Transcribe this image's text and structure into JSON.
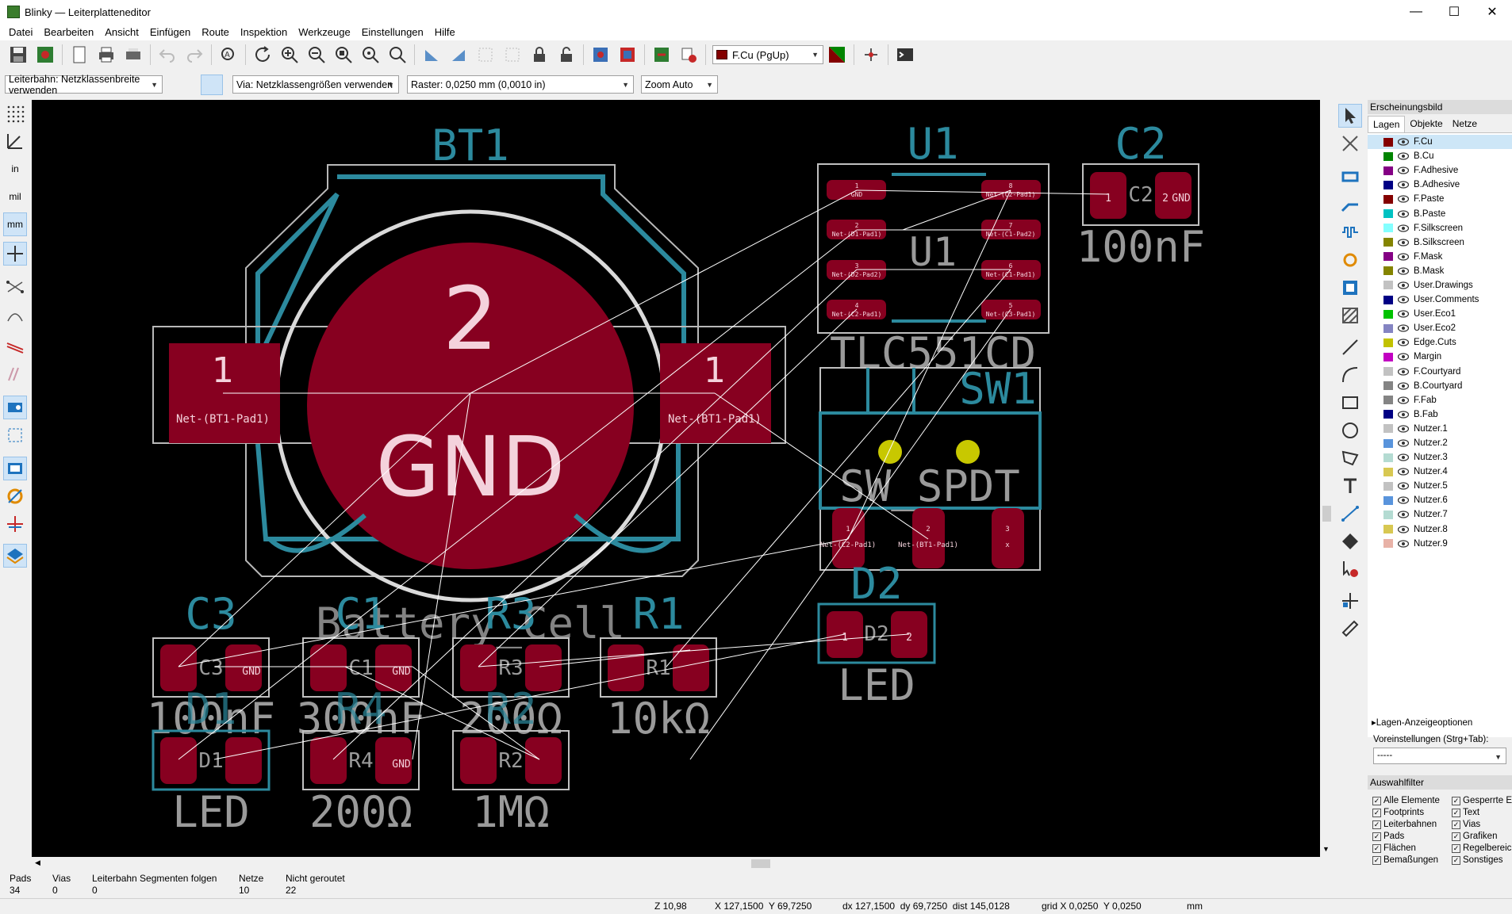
{
  "window": {
    "title": "Blinky — Leiterplatteneditor",
    "minimize": "—",
    "maximize": "☐",
    "close": "✕"
  },
  "menu": [
    "Datei",
    "Bearbeiten",
    "Ansicht",
    "Einfügen",
    "Route",
    "Inspektion",
    "Werkzeuge",
    "Einstellungen",
    "Hilfe"
  ],
  "toolbar": {
    "layer_select": "F.Cu (PgUp)",
    "layer_color": "#840000"
  },
  "toolbar2": {
    "track_width": "Leiterbahn: Netzklassenbreite verwenden",
    "via_size": "Via: Netzklassengrößen verwenden",
    "grid": "Raster: 0,0250 mm (0,0010 in)",
    "zoom": "Zoom Auto"
  },
  "left_tools": {
    "unit_in": "in",
    "unit_mil": "mil",
    "unit_mm": "mm"
  },
  "pcb": {
    "bt1": {
      "ref": "BT1",
      "value": "Battery_Cell",
      "pad_center_num": "2",
      "pad_center_net": "GND",
      "pad_num": "1",
      "pad_net": "Net-(BT1-Pad1)"
    },
    "u1": {
      "ref": "U1",
      "value": "TLC551CD",
      "ref_center": "U1",
      "pads_left": [
        {
          "num": "1",
          "net": "GND"
        },
        {
          "num": "2",
          "net": "Net-(D1-Pad1)"
        },
        {
          "num": "3",
          "net": "Net-(D2-Pad2)"
        },
        {
          "num": "4",
          "net": "Net-(C2-Pad1)"
        }
      ],
      "pads_right": [
        {
          "num": "8",
          "net": "Net-(C2-Pad1)"
        },
        {
          "num": "7",
          "net": "Net-(C1-Pad2)"
        },
        {
          "num": "6",
          "net": "Net-(C1-Pad1)"
        },
        {
          "num": "5",
          "net": "Net-(C3-Pad1)"
        }
      ]
    },
    "c2": {
      "ref": "C2",
      "value": "100nF",
      "ref_center": "C2",
      "pad1": "1",
      "pad2": "2",
      "pad2_net": "GND"
    },
    "sw1": {
      "ref": "SW1",
      "value": "SW_SPDT",
      "pads": [
        {
          "num": "1",
          "net": "Net-(C2-Pad1)"
        },
        {
          "num": "2",
          "net": "Net-(BT1-Pad1)"
        },
        {
          "num": "3",
          "net": "x"
        }
      ]
    },
    "d2": {
      "ref": "D2",
      "value": "LED",
      "ref_center": "D2",
      "pad1": "1",
      "pad2": "2"
    },
    "c3": {
      "ref": "C3",
      "value": "100nF",
      "ref_center": "C3",
      "pad2_net": "GND"
    },
    "c1": {
      "ref": "C1",
      "value": "300nF",
      "ref_center": "C1",
      "pad2_net": "GND"
    },
    "r3": {
      "ref": "R3",
      "value": "200Ω",
      "ref_center": "R3"
    },
    "r1": {
      "ref": "R1",
      "value": "10kΩ",
      "ref_center": "R1"
    },
    "d1": {
      "ref": "D1",
      "value": "LED",
      "ref_center": "D1"
    },
    "r4": {
      "ref": "R4",
      "value": "200Ω",
      "ref_center": "R4",
      "pad2_net": "GND"
    },
    "r2": {
      "ref": "R2",
      "value": "1MΩ",
      "ref_center": "R2"
    }
  },
  "panel": {
    "header": "Erscheinungsbild",
    "tabs": [
      "Lagen",
      "Objekte",
      "Netze"
    ],
    "layers": [
      {
        "name": "F.Cu",
        "color": "#840000"
      },
      {
        "name": "B.Cu",
        "color": "#008400"
      },
      {
        "name": "F.Adhesive",
        "color": "#840084"
      },
      {
        "name": "B.Adhesive",
        "color": "#000084"
      },
      {
        "name": "F.Paste",
        "color": "#840000"
      },
      {
        "name": "B.Paste",
        "color": "#00c2c2"
      },
      {
        "name": "F.Silkscreen",
        "color": "#84ffff"
      },
      {
        "name": "B.Silkscreen",
        "color": "#848400"
      },
      {
        "name": "F.Mask",
        "color": "#840084"
      },
      {
        "name": "B.Mask",
        "color": "#848400"
      },
      {
        "name": "User.Drawings",
        "color": "#c2c2c2"
      },
      {
        "name": "User.Comments",
        "color": "#000084"
      },
      {
        "name": "User.Eco1",
        "color": "#00c200"
      },
      {
        "name": "User.Eco2",
        "color": "#8484c2"
      },
      {
        "name": "Edge.Cuts",
        "color": "#c2c200"
      },
      {
        "name": "Margin",
        "color": "#c200c2"
      },
      {
        "name": "F.Courtyard",
        "color": "#c2c2c2"
      },
      {
        "name": "B.Courtyard",
        "color": "#848484"
      },
      {
        "name": "F.Fab",
        "color": "#848484"
      },
      {
        "name": "B.Fab",
        "color": "#000084"
      },
      {
        "name": "Nutzer.1",
        "color": "#c2c2c2"
      },
      {
        "name": "Nutzer.2",
        "color": "#5994dc"
      },
      {
        "name": "Nutzer.3",
        "color": "#b4dbd2"
      },
      {
        "name": "Nutzer.4",
        "color": "#d8c852"
      },
      {
        "name": "Nutzer.5",
        "color": "#c2c2c2"
      },
      {
        "name": "Nutzer.6",
        "color": "#5994dc"
      },
      {
        "name": "Nutzer.7",
        "color": "#b4dbd2"
      },
      {
        "name": "Nutzer.8",
        "color": "#d8c852"
      },
      {
        "name": "Nutzer.9",
        "color": "#e8b2a7"
      }
    ],
    "layer_options": "Lagen-Anzeigeoptionen",
    "presets_label": "Voreinstellungen (Strg+Tab):",
    "presets_value": "-----",
    "filter_header": "Auswahlfilter",
    "filters_left": [
      "Alle Elemente",
      "Footprints",
      "Leiterbahnen",
      "Pads",
      "Flächen",
      "Bemaßungen"
    ],
    "filters_right": [
      "Gesperrte E",
      "Text",
      "Vias",
      "Grafiken",
      "Regelbereic",
      "Sonstiges"
    ]
  },
  "status": {
    "pads_label": "Pads",
    "pads_value": "34",
    "vias_label": "Vias",
    "vias_value": "0",
    "follow_label": "Leiterbahn Segmenten folgen",
    "follow_value": "0",
    "nets_label": "Netze",
    "nets_value": "10",
    "unrouted_label": "Nicht geroutet",
    "unrouted_value": "22",
    "zoom": "Z 10,98",
    "xy": "X 127,1500  Y 69,7250",
    "dxdy": "dx 127,1500  dy 69,7250  dist 145,0128",
    "grid": "grid X 0,0250  Y 0,0250",
    "units": "mm"
  }
}
